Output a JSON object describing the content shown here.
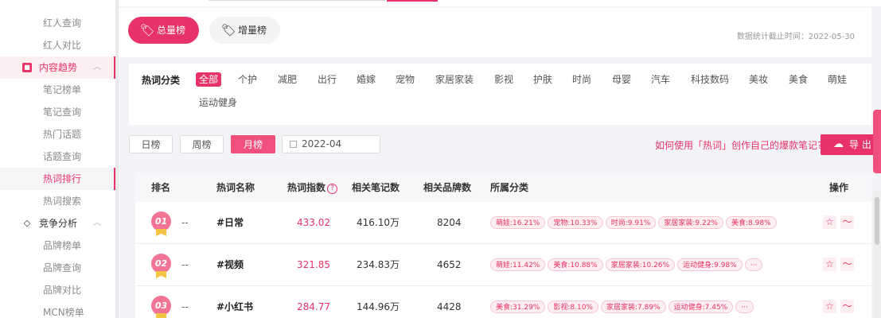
{
  "sidebar": {
    "items": [
      {
        "label": "红人查询"
      },
      {
        "label": "红人对比"
      },
      {
        "label": "内容趋势",
        "group": true,
        "icon": "content-trend-icon"
      },
      {
        "label": "笔记榜单"
      },
      {
        "label": "笔记查询"
      },
      {
        "label": "热门话题"
      },
      {
        "label": "话题查询"
      },
      {
        "label": "热词排行",
        "active": true
      },
      {
        "label": "热词搜索"
      },
      {
        "label": "竞争分析",
        "group": true,
        "icon": "diamond-icon"
      },
      {
        "label": "品牌榜单"
      },
      {
        "label": "品牌查询"
      },
      {
        "label": "品牌对比"
      },
      {
        "label": "MCN榜单"
      }
    ]
  },
  "header": {
    "tab_total": "总量榜",
    "tab_increment": "增量榜",
    "stat_note": "数据统计截止时间：2022-05-30"
  },
  "categories": {
    "title": "热词分类",
    "items": [
      "全部",
      "个护",
      "减肥",
      "出行",
      "婚嫁",
      "宠物",
      "家居家装",
      "影视",
      "护肤",
      "时尚",
      "母婴",
      "汽车",
      "科技数码",
      "美妆",
      "美食",
      "萌娃",
      "运动健身"
    ],
    "selected": "全部"
  },
  "filters": {
    "day": "日榜",
    "week": "周榜",
    "month": "月榜",
    "selected": "月榜",
    "date_value": "2022-04",
    "help_link": "如何使用「热词」创作自己的爆款笔记?",
    "export": "导 出"
  },
  "table": {
    "headers": {
      "rank": "排名",
      "name": "热词名称",
      "index": "热词指数",
      "notes": "相关笔记数",
      "brands": "相关品牌数",
      "category": "所属分类",
      "action": "操作"
    },
    "rows": [
      {
        "rank": "01",
        "change": "--",
        "name": "#日常",
        "index": "433.02",
        "notes": "416.10万",
        "brands": "8204",
        "tags": [
          "萌娃:16.21%",
          "宠物:10.33%",
          "时尚:9.91%",
          "家居家装:9.22%",
          "美食:8.98%"
        ]
      },
      {
        "rank": "02",
        "change": "--",
        "name": "#视频",
        "index": "321.85",
        "notes": "234.83万",
        "brands": "4652",
        "tags": [
          "萌娃:11.42%",
          "美食:10.88%",
          "家居家装:10.26%",
          "运动健身:9.98%",
          "···"
        ]
      },
      {
        "rank": "03",
        "change": "--",
        "name": "#小红书",
        "index": "284.77",
        "notes": "144.96万",
        "brands": "4428",
        "tags": [
          "美食:31.29%",
          "影视:8.10%",
          "家居家装:7.89%",
          "运动健身:7.45%",
          "···"
        ]
      }
    ]
  },
  "colors": {
    "accent": "#e8336a",
    "medal": "#f27495",
    "ribbon": "#f6c445"
  },
  "icons": {
    "tab": "tag-icon",
    "favorite": "star-icon",
    "trend": "trend-icon",
    "export": "cloud-upload-icon",
    "help": "question-icon"
  }
}
